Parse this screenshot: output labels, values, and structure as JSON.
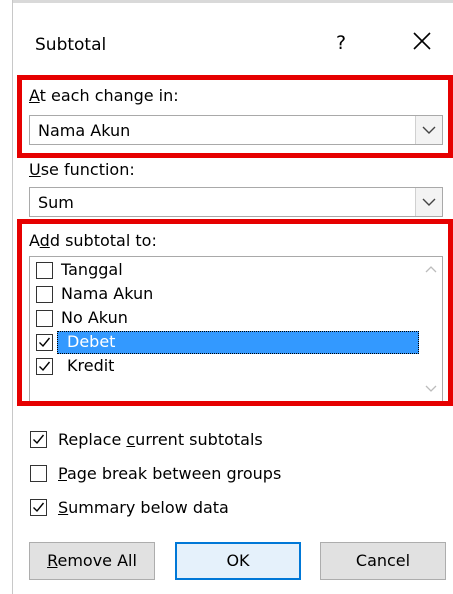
{
  "dialog": {
    "title": "Subtotal",
    "help_label": "?",
    "accent_color": "#e60000"
  },
  "change_in": {
    "label_prefix": "A",
    "label_rest": "t each change in:",
    "value": "Nama Akun"
  },
  "function": {
    "label_prefix": "U",
    "label_rest": "se function:",
    "value": "Sum"
  },
  "add_subtotal": {
    "label_pre": "A",
    "label_ul": "d",
    "label_rest": "d subtotal to:",
    "items": [
      {
        "label": "Tanggal",
        "checked": false,
        "selected": false
      },
      {
        "label": "Nama Akun",
        "checked": false,
        "selected": false
      },
      {
        "label": "No Akun",
        "checked": false,
        "selected": false
      },
      {
        "label": "Debet",
        "checked": true,
        "selected": true
      },
      {
        "label": "Kredit",
        "checked": true,
        "selected": false
      }
    ]
  },
  "options": {
    "replace": {
      "pre": "Replace ",
      "ul": "c",
      "rest": "urrent subtotals",
      "checked": true
    },
    "page_break": {
      "pre": "",
      "ul": "P",
      "rest": "age break between groups",
      "checked": false
    },
    "summary": {
      "pre": "",
      "ul": "S",
      "rest": "ummary below data",
      "checked": true
    }
  },
  "buttons": {
    "remove_all_ul": "R",
    "remove_all_rest": "emove All",
    "ok": "OK",
    "cancel": "Cancel"
  }
}
